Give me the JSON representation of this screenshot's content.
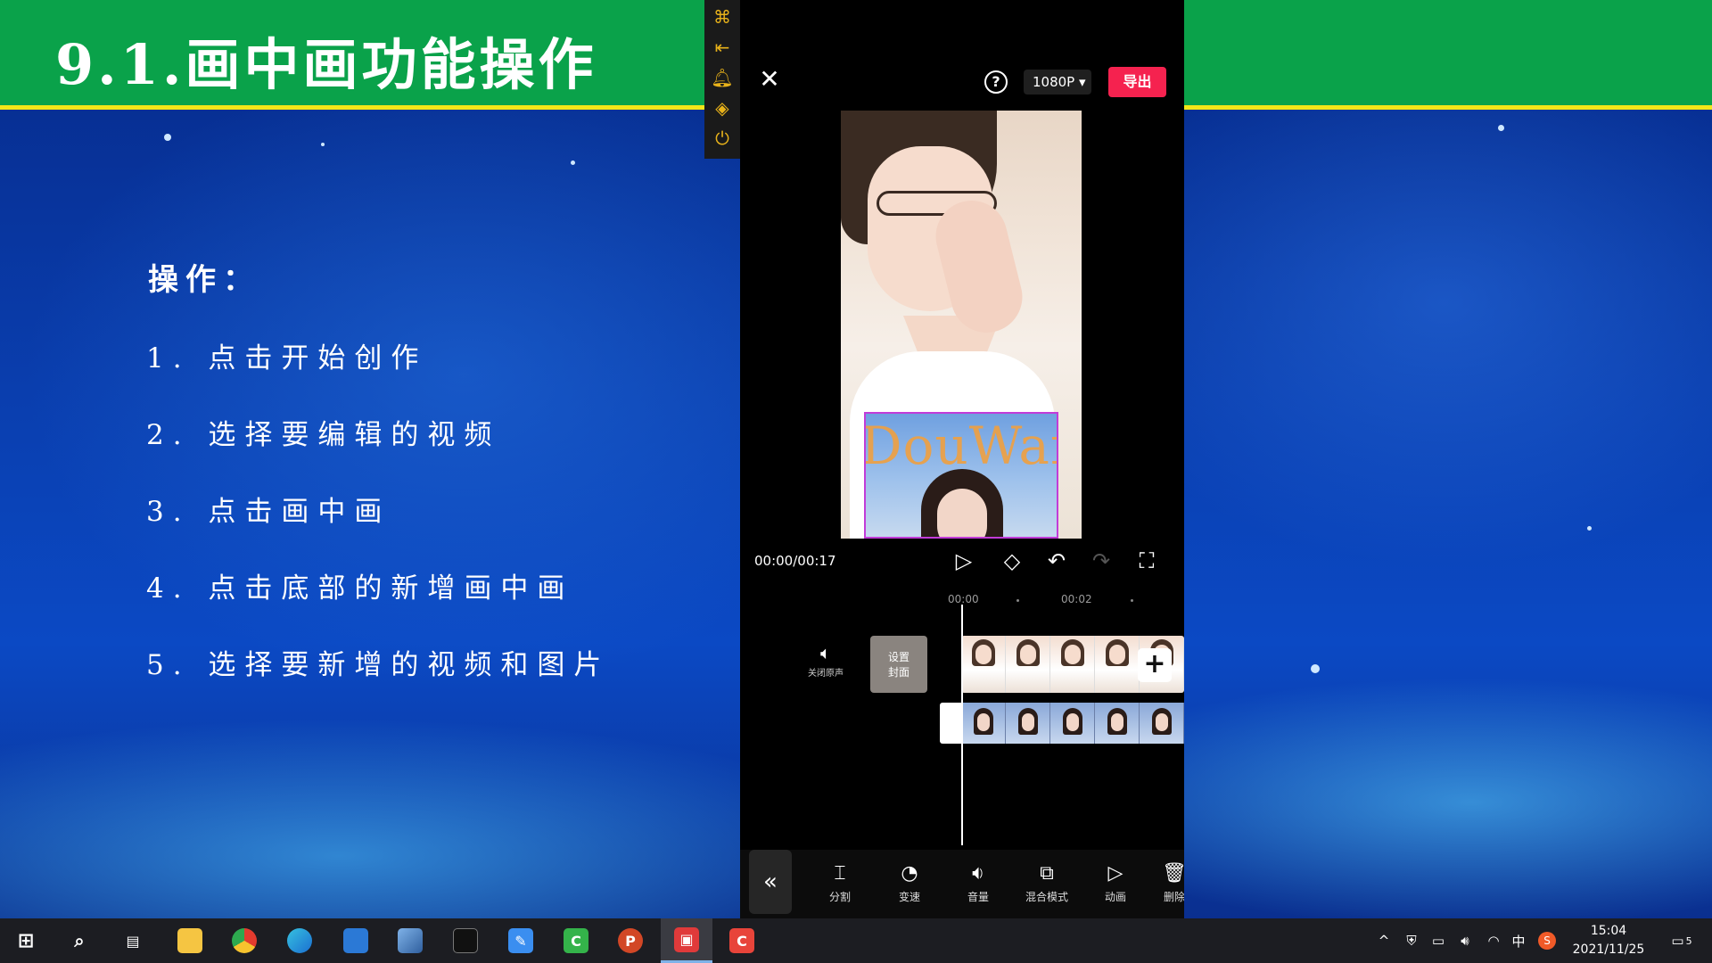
{
  "slide": {
    "title": "9.1.画中画功能操作",
    "heading": "操作：",
    "steps": [
      "1. 点击开始创作",
      "2. 选择要编辑的视频",
      "3. 点击画中画",
      "4. 点击底部的新增画中画",
      "5. 选择要新增的视频和图片"
    ]
  },
  "editor": {
    "resolution": "1080P",
    "resolution_icon": "caret-down-icon",
    "export_label": "导出",
    "help_label": "?",
    "time": "00:00/00:17",
    "watermark": "DouWan",
    "ruler": [
      "00:00",
      "00:02"
    ],
    "mute_label": "关闭原声",
    "cover_label_1": "设置",
    "cover_label_2": "封面",
    "add_symbol": "+",
    "tools": [
      "分割",
      "变速",
      "音量",
      "混合模式",
      "动画",
      "删除"
    ]
  },
  "taskbar": {
    "time": "15:04",
    "date": "2021/11/25",
    "ime": "中",
    "notifications": "5"
  },
  "colors": {
    "title_bg": "#0aa24a",
    "title_underline": "#f3e619",
    "export_btn": "#f5224f",
    "pip_border": "#c23cd8"
  }
}
